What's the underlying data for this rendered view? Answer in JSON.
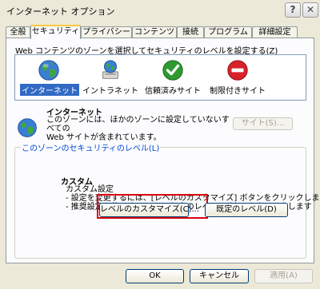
{
  "window": {
    "title": "インターネット オプション"
  },
  "titlebar": {
    "help_label": "?",
    "close_label": "✕"
  },
  "tabs": [
    {
      "label": "全般"
    },
    {
      "label": "セキュリティ"
    },
    {
      "label": "プライバシー"
    },
    {
      "label": "コンテンツ"
    },
    {
      "label": "接続"
    },
    {
      "label": "プログラム"
    },
    {
      "label": "詳細設定"
    }
  ],
  "active_tab": "セキュリティ",
  "zones": {
    "instruction": "Web コンテンツのゾーンを選択してセキュリティのレベルを設定する(Z)",
    "items": [
      {
        "label": "インターネット",
        "icon": "globe-icon",
        "selected": true
      },
      {
        "label": "イントラネット",
        "icon": "intranet-icon",
        "selected": false
      },
      {
        "label": "信頼済みサイト",
        "icon": "check-icon",
        "selected": false
      },
      {
        "label": "制限付きサイト",
        "icon": "restricted-icon",
        "selected": false
      }
    ]
  },
  "zone_description": {
    "title": "インターネット",
    "lines": [
      "このゾーンには、ほかのゾーンに設定していないすべての",
      "Web サイトが含まれています。"
    ],
    "sites_button": "サイト(S)..."
  },
  "security_level": {
    "legend": "このゾーンのセキュリティのレベル(L)",
    "level_name": "カスタム",
    "lines": [
      "カスタム設定",
      " - 設定を変更するには、[レベルのカスタマイズ] ボタンをクリックします",
      " - 推奨設定を使用するには、[既定のレベル] ボタンをクリックします"
    ],
    "customize_button": "レベルのカスタマイズ(C)...",
    "default_button": "既定のレベル(D)"
  },
  "dialog_buttons": {
    "ok": "OK",
    "cancel": "キャンセル",
    "apply": "適用(A)"
  },
  "colors": {
    "selection": "#316ac5",
    "legend_text": "#0046d5",
    "highlight_box": "#d9000f",
    "tab_active_accent": "#ffc83c"
  }
}
